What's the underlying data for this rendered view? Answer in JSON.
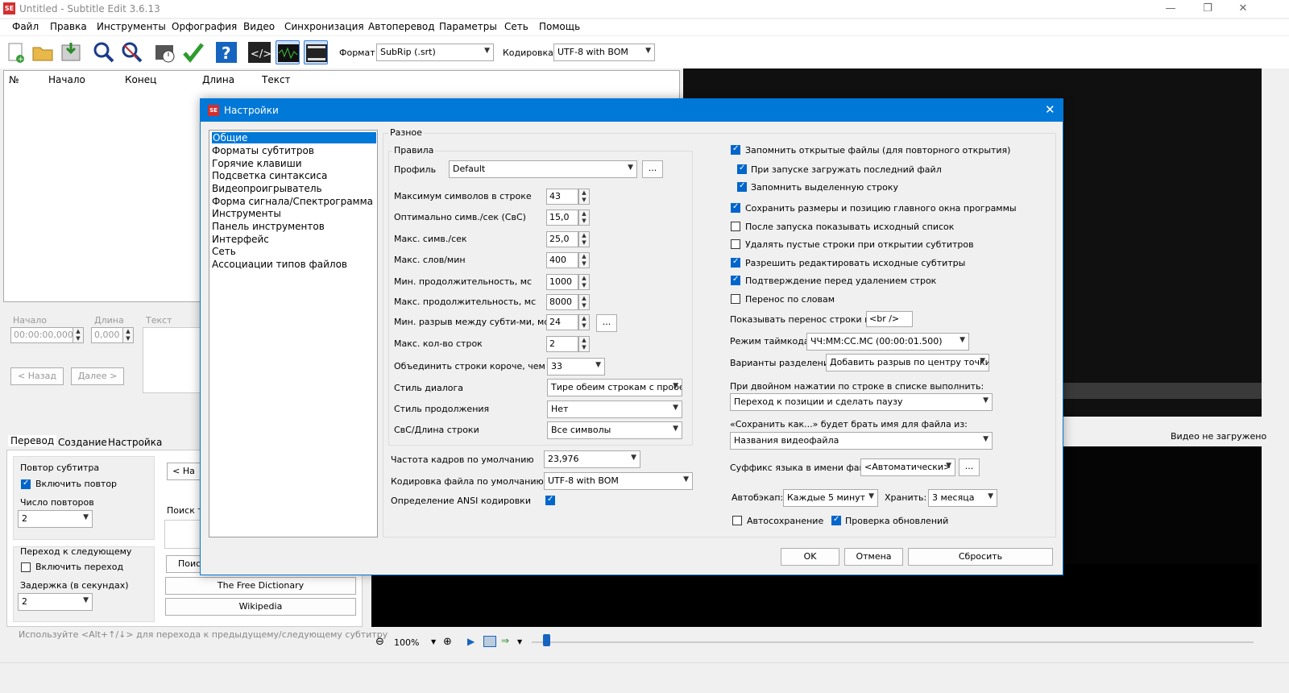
{
  "app": {
    "logo": "SE",
    "title": "Untitled - Subtitle Edit 3.6.13"
  },
  "menu": [
    "Файл",
    "Правка",
    "Инструменты",
    "Орфография",
    "Видео",
    "Синхронизация",
    "Автоперевод",
    "Параметры",
    "Сеть",
    "Помощь"
  ],
  "toolbar": {
    "format_label": "Формат",
    "format_value": "SubRip (.srt)",
    "encoding_label": "Кодировка",
    "encoding_value": "UTF-8 with BOM"
  },
  "grid": {
    "columns": [
      "№",
      "Начало",
      "Конец",
      "Длина",
      "Текст"
    ]
  },
  "editor": {
    "start_label": "Начало",
    "duration_label": "Длина",
    "text_label": "Текст",
    "start_value": "00:00:00,000",
    "duration_value": "0,000",
    "prev_btn": "< Назад",
    "next_btn": "Далее >"
  },
  "bottom_tabs": [
    "Перевод",
    "Создание",
    "Настройка"
  ],
  "repeat": {
    "title": "Повтор субтитра",
    "enable": "Включить повтор",
    "count_label": "Число повторов",
    "count_value": "2"
  },
  "next": {
    "title": "Переход к следующему",
    "enable": "Включить переход",
    "delay_label": "Задержка (в секундах)",
    "delay_value": "2"
  },
  "search": {
    "prev_btn": "< На",
    "label": "Поиск т",
    "search_btn": "Поис",
    "dict1": "The Free Dictionary",
    "dict2": "Wikipedia"
  },
  "hint": "Используйте <Alt+↑/↓> для перехода к предыдущему/следующему субтитру",
  "video": {
    "status": "Видео не загружено",
    "zoom": "100%"
  },
  "dialog": {
    "logo": "SE",
    "title": "Настройки",
    "tree": [
      "Общие",
      "Форматы субтитров",
      "Горячие клавиши",
      "Подсветка синтаксиса",
      "Видеопроигрыватель",
      "Форма сигнала/Спектрограмма",
      "Инструменты",
      "Панель инструментов",
      "Интерфейс",
      "Сеть",
      "Ассоциации типов файлов"
    ],
    "misc_group": "Разное",
    "rules_group": "Правила",
    "profile_label": "Профиль",
    "profile_value": "Default",
    "rules": [
      {
        "label": "Максимум символов в строке",
        "value": "43"
      },
      {
        "label": "Оптимально симв./сек (СвС)",
        "value": "15,0"
      },
      {
        "label": "Макс. симв./сек",
        "value": "25,0"
      },
      {
        "label": "Макс. слов/мин",
        "value": "400"
      },
      {
        "label": "Мин. продолжительность, мс",
        "value": "1000"
      },
      {
        "label": "Макс. продолжительность, мс",
        "value": "8000"
      },
      {
        "label": "Мин. разрыв между субти-ми, мс",
        "value": "24"
      },
      {
        "label": "Макс. кол-во строк",
        "value": "2"
      }
    ],
    "merge_label": "Объединить строки короче, чем",
    "merge_value": "33",
    "dialog_style_label": "Стиль диалога",
    "dialog_style_value": "Тире обеим строкам с пробел",
    "continuation_label": "Стиль продолжения",
    "continuation_value": "Нет",
    "cps_label": "СвС/Длина строки",
    "cps_value": "Все символы",
    "fps_label": "Частота кадров по умолчанию",
    "fps_value": "23,976",
    "enc_label": "Кодировка файла по умолчанию",
    "enc_value": "UTF-8 with BOM",
    "ansi_label": "Определение ANSI кодировки",
    "checks": [
      {
        "label": "Запомнить открытые файлы (для повторного открытия)",
        "on": true
      },
      {
        "label": "При запуске загружать последний файл",
        "on": true
      },
      {
        "label": "Запомнить выделенную строку",
        "on": true
      },
      {
        "label": "Сохранить размеры и позицию главного окна программы",
        "on": true
      },
      {
        "label": "После запуска показывать исходный список",
        "on": false
      },
      {
        "label": "Удалять пустые строки при открытии субтитров",
        "on": false
      },
      {
        "label": "Разрешить редактировать исходные субтитры",
        "on": true
      },
      {
        "label": "Подтверждение перед удалением строк",
        "on": true
      },
      {
        "label": "Перенос по словам",
        "on": false
      }
    ],
    "linebreak_label": "Показывать перенос строки как:",
    "linebreak_value": "<br />",
    "timecode_label": "Режим таймкода:",
    "timecode_value": "ЧЧ:ММ:СС.МС (00:00:01.500)",
    "split_label": "Варианты разделения",
    "split_value": "Добавить разрыв по центру точки р",
    "dblclick_label": "При двойном нажатии по строке в списке выполнить:",
    "dblclick_value": "Переход к позиции и сделать паузу",
    "saveas_label": "«Сохранить как...» будет брать имя для файла из:",
    "saveas_value": "Названия видеофайла",
    "langsuffix_label": "Суффикс языка в имени файла",
    "langsuffix_value": "<Автоматически>",
    "autobackup_label": "Автобэкап:",
    "autobackup_value": "Каждые 5 минут",
    "keep_label": "Хранить:",
    "keep_value": "3 месяца",
    "autosave_label": "Автосохранение",
    "updates_label": "Проверка обновлений",
    "ok": "OK",
    "cancel": "Отмена",
    "reset": "Сбросить"
  }
}
